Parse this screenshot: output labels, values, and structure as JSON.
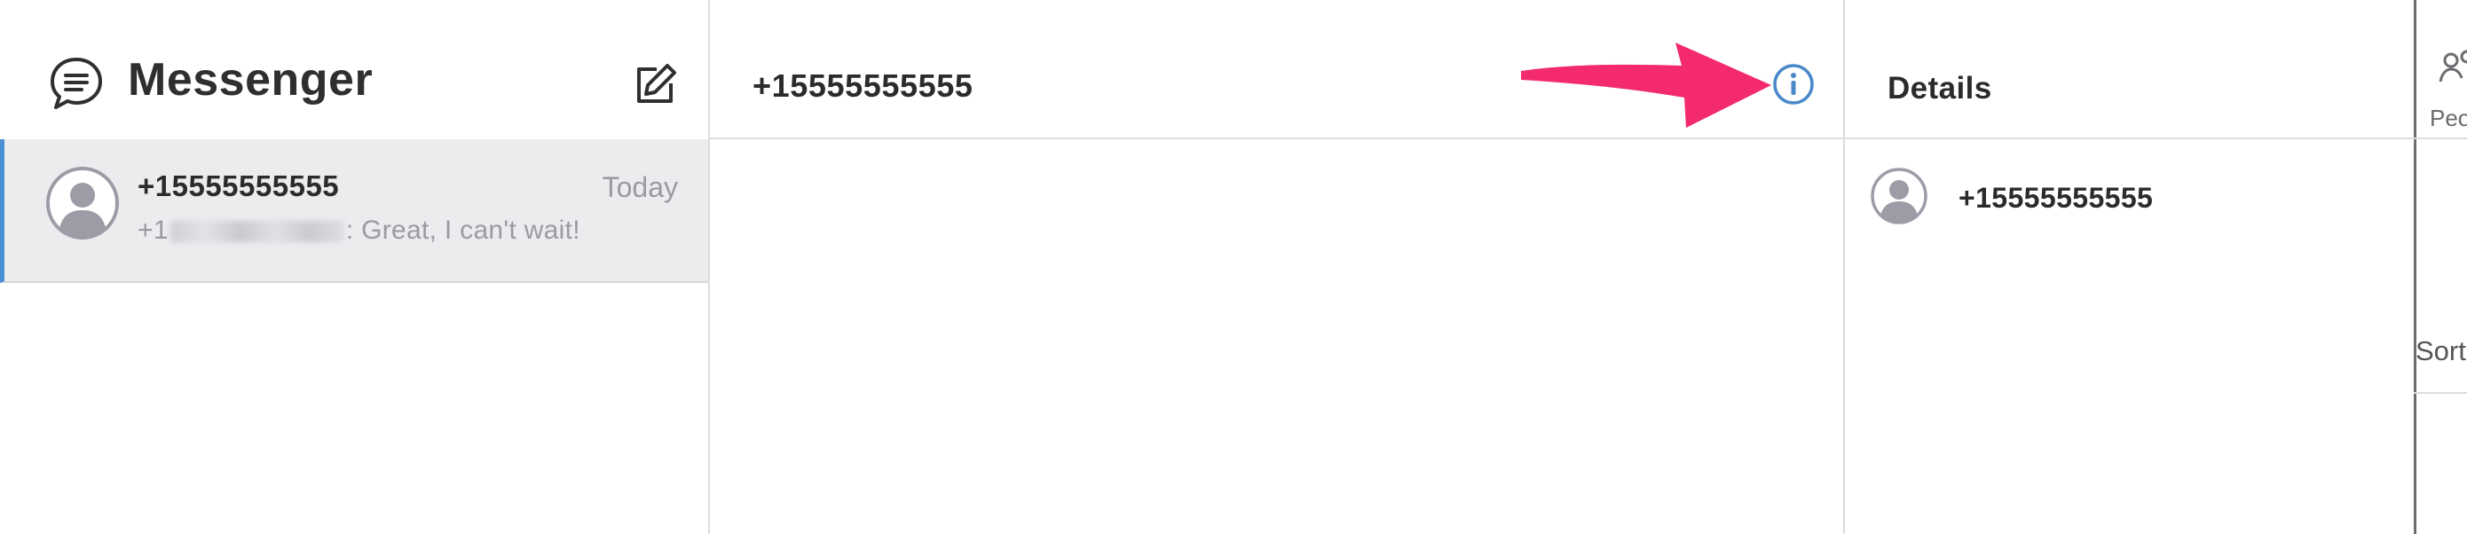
{
  "app": {
    "title": "Messenger",
    "icons": {
      "logo": "chat-bubble-icon",
      "compose": "compose-icon"
    }
  },
  "conversations": [
    {
      "name": "+15555555555",
      "time": "Today",
      "preview_prefix": "+1",
      "preview_text": ": Great, I can't wait!",
      "selected": true,
      "avatar_icon": "person-avatar-icon"
    }
  ],
  "thread": {
    "title": "+15555555555",
    "info_icon": "info-icon"
  },
  "details": {
    "title": "Details",
    "contact": "+15555555555",
    "avatar_icon": "person-avatar-icon"
  },
  "side_panel": {
    "people_label": "Peo",
    "sort_label": "Sort",
    "people_icon": "people-icon"
  },
  "colors": {
    "accent": "#4a8fd6",
    "selected_bg": "#ebecee",
    "annotation_arrow": "#f32a6e",
    "info_icon": "#4a88c8",
    "muted_text": "#9a9aa3"
  }
}
